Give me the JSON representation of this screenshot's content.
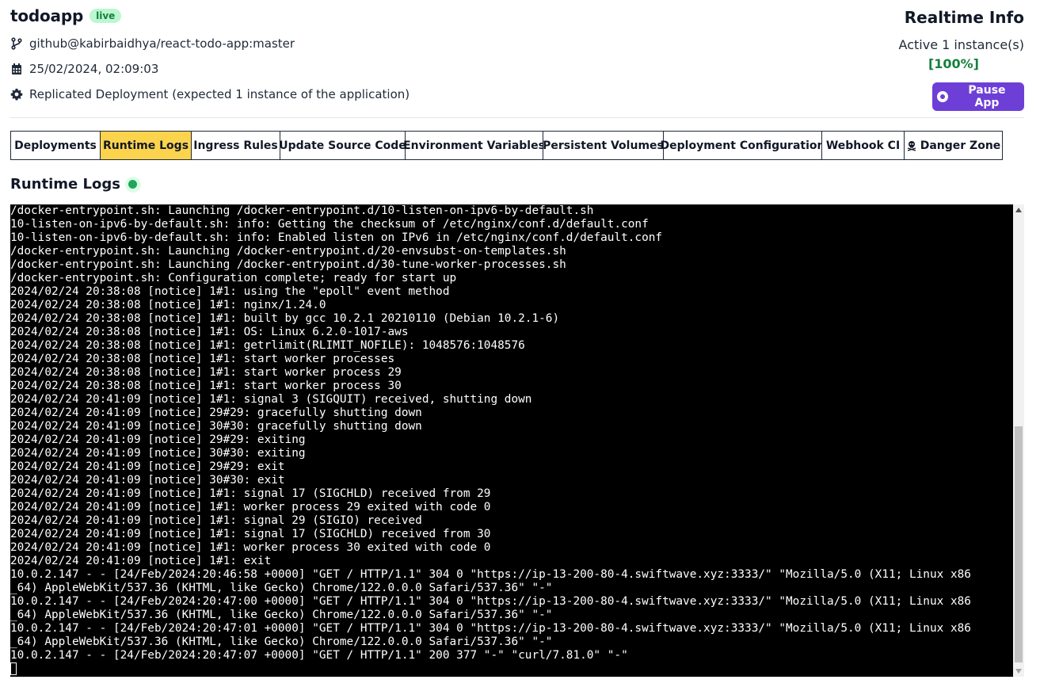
{
  "header": {
    "app_name": "todoapp",
    "status_badge": "live",
    "repo": "github@kabirbaidhya/react-todo-app:master",
    "deployed_at": "25/02/2024, 02:09:03",
    "deployment_mode": "Replicated Deployment (expected 1 instance of the application)"
  },
  "realtime": {
    "title": "Realtime Info",
    "instances": "Active 1 instance(s)",
    "health_percent": "[100%]",
    "pause_label": "Pause App"
  },
  "tabs": [
    {
      "label": "Deployments",
      "active": false
    },
    {
      "label": "Runtime Logs",
      "active": true
    },
    {
      "label": "Ingress Rules",
      "active": false
    },
    {
      "label": "Update Source Code",
      "active": false
    },
    {
      "label": "Environment Variables",
      "active": false
    },
    {
      "label": "Persistent Volumes",
      "active": false
    },
    {
      "label": "Deployment Configuration",
      "active": false
    },
    {
      "label": "Webhook CI",
      "active": false
    },
    {
      "label": "Danger Zone",
      "active": false,
      "icon": "skull-crossbones-icon"
    }
  ],
  "logs": {
    "title": "Runtime Logs",
    "lines": [
      "/docker-entrypoint.sh: Launching /docker-entrypoint.d/10-listen-on-ipv6-by-default.sh",
      "10-listen-on-ipv6-by-default.sh: info: Getting the checksum of /etc/nginx/conf.d/default.conf",
      "10-listen-on-ipv6-by-default.sh: info: Enabled listen on IPv6 in /etc/nginx/conf.d/default.conf",
      "/docker-entrypoint.sh: Launching /docker-entrypoint.d/20-envsubst-on-templates.sh",
      "/docker-entrypoint.sh: Launching /docker-entrypoint.d/30-tune-worker-processes.sh",
      "/docker-entrypoint.sh: Configuration complete; ready for start up",
      "2024/02/24 20:38:08 [notice] 1#1: using the \"epoll\" event method",
      "2024/02/24 20:38:08 [notice] 1#1: nginx/1.24.0",
      "2024/02/24 20:38:08 [notice] 1#1: built by gcc 10.2.1 20210110 (Debian 10.2.1-6)",
      "2024/02/24 20:38:08 [notice] 1#1: OS: Linux 6.2.0-1017-aws",
      "2024/02/24 20:38:08 [notice] 1#1: getrlimit(RLIMIT_NOFILE): 1048576:1048576",
      "2024/02/24 20:38:08 [notice] 1#1: start worker processes",
      "2024/02/24 20:38:08 [notice] 1#1: start worker process 29",
      "2024/02/24 20:38:08 [notice] 1#1: start worker process 30",
      "2024/02/24 20:41:09 [notice] 1#1: signal 3 (SIGQUIT) received, shutting down",
      "2024/02/24 20:41:09 [notice] 29#29: gracefully shutting down",
      "2024/02/24 20:41:09 [notice] 30#30: gracefully shutting down",
      "2024/02/24 20:41:09 [notice] 29#29: exiting",
      "2024/02/24 20:41:09 [notice] 30#30: exiting",
      "2024/02/24 20:41:09 [notice] 29#29: exit",
      "2024/02/24 20:41:09 [notice] 30#30: exit",
      "2024/02/24 20:41:09 [notice] 1#1: signal 17 (SIGCHLD) received from 29",
      "2024/02/24 20:41:09 [notice] 1#1: worker process 29 exited with code 0",
      "2024/02/24 20:41:09 [notice] 1#1: signal 29 (SIGIO) received",
      "2024/02/24 20:41:09 [notice] 1#1: signal 17 (SIGCHLD) received from 30",
      "2024/02/24 20:41:09 [notice] 1#1: worker process 30 exited with code 0",
      "2024/02/24 20:41:09 [notice] 1#1: exit",
      "10.0.2.147 - - [24/Feb/2024:20:46:58 +0000] \"GET / HTTP/1.1\" 304 0 \"https://ip-13-200-80-4.swiftwave.xyz:3333/\" \"Mozilla/5.0 (X11; Linux x86",
      "_64) AppleWebKit/537.36 (KHTML, like Gecko) Chrome/122.0.0.0 Safari/537.36\" \"-\"",
      "10.0.2.147 - - [24/Feb/2024:20:47:00 +0000] \"GET / HTTP/1.1\" 304 0 \"https://ip-13-200-80-4.swiftwave.xyz:3333/\" \"Mozilla/5.0 (X11; Linux x86",
      "_64) AppleWebKit/537.36 (KHTML, like Gecko) Chrome/122.0.0.0 Safari/537.36\" \"-\"",
      "10.0.2.147 - - [24/Feb/2024:20:47:01 +0000] \"GET / HTTP/1.1\" 304 0 \"https://ip-13-200-80-4.swiftwave.xyz:3333/\" \"Mozilla/5.0 (X11; Linux x86",
      "_64) AppleWebKit/537.36 (KHTML, like Gecko) Chrome/122.0.0.0 Safari/537.36\" \"-\"",
      "10.0.2.147 - - [24/Feb/2024:20:47:07 +0000] \"GET / HTTP/1.1\" 200 377 \"-\" \"curl/7.81.0\" \"-\""
    ]
  },
  "colors": {
    "accent": "#6d3fd6",
    "active_tab": "#fcd34d",
    "live_badge_bg": "#bbf7d0",
    "live_badge_text": "#15803d",
    "status_dot": "#22a55b",
    "terminal_bg": "#000000"
  }
}
